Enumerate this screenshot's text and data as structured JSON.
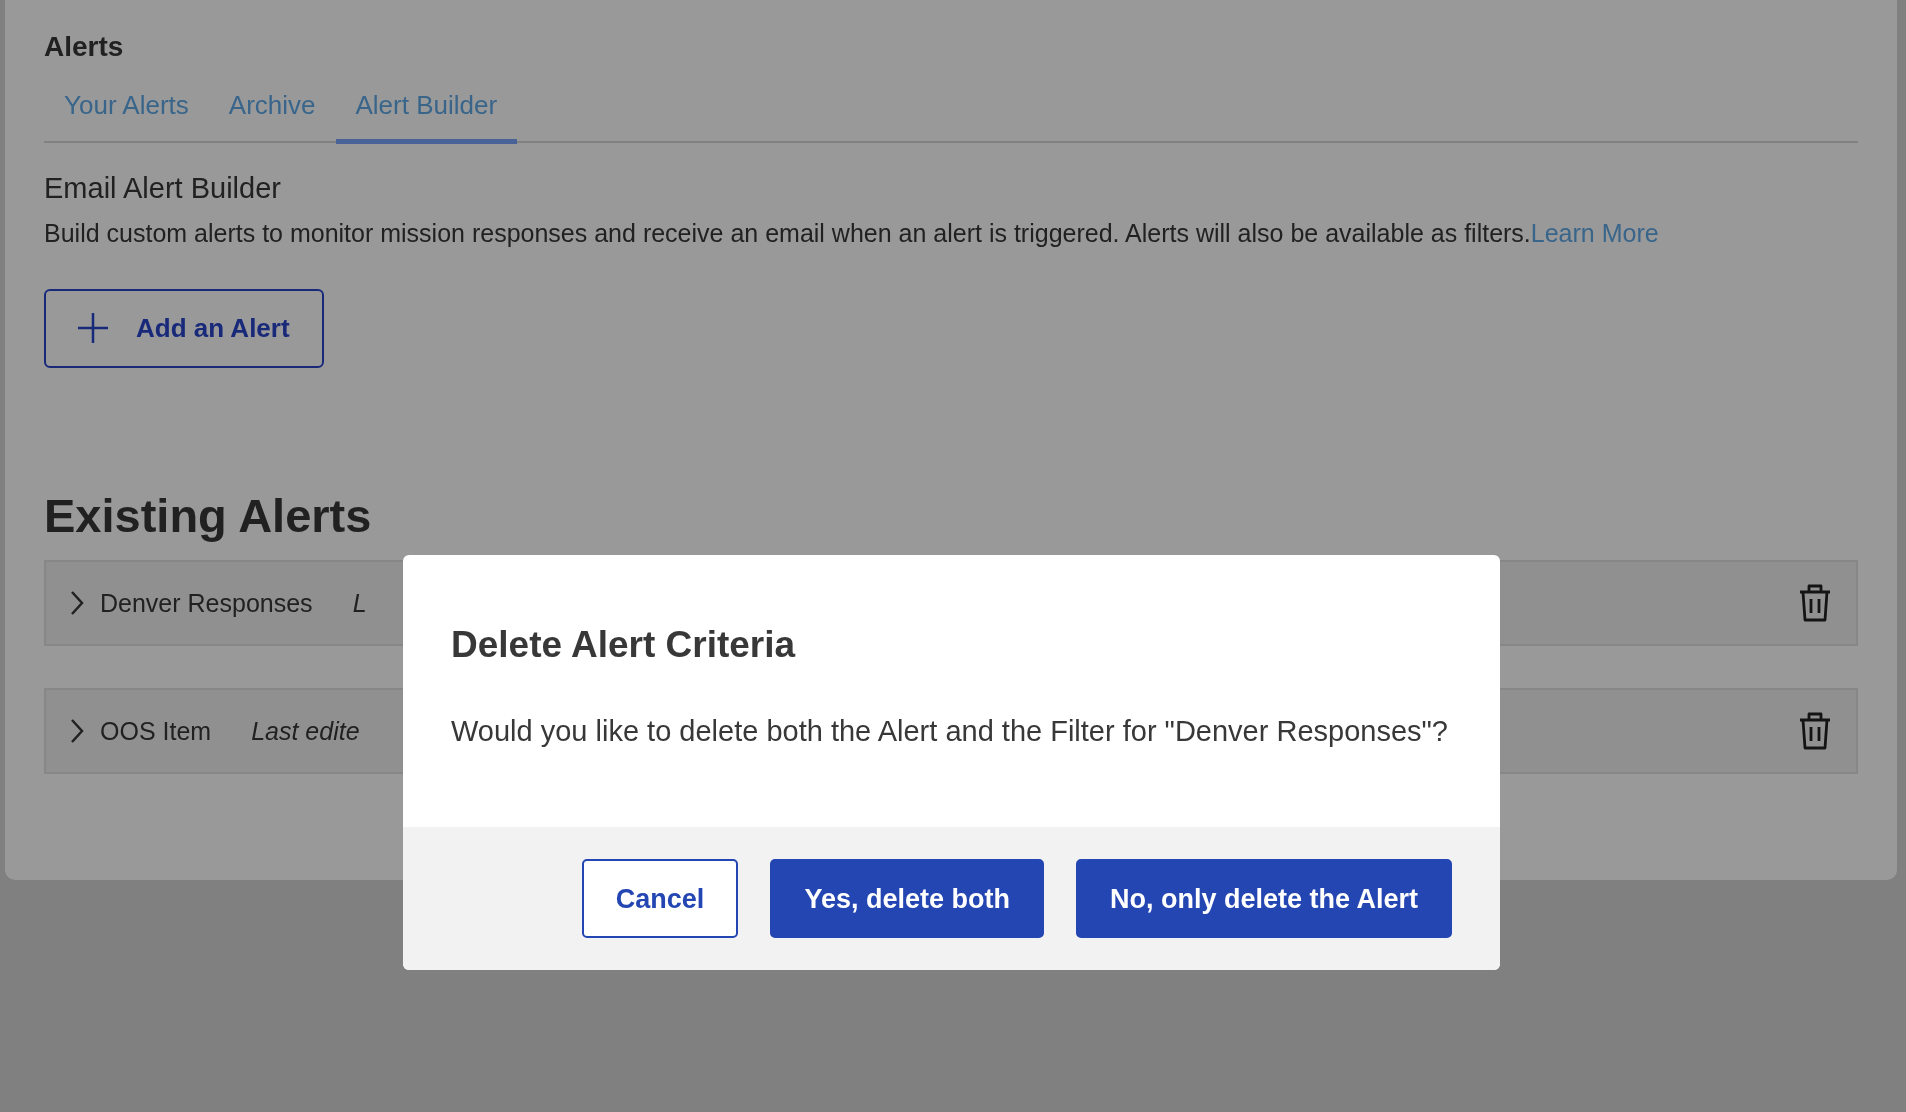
{
  "page": {
    "title": "Alerts"
  },
  "tabs": [
    {
      "label": "Your Alerts",
      "selected": false
    },
    {
      "label": "Archive",
      "selected": false
    },
    {
      "label": "Alert Builder",
      "selected": true
    }
  ],
  "builder": {
    "title": "Email Alert Builder",
    "description": "Build custom alerts to monitor mission responses and receive an email when an alert is triggered. Alerts will also be available as filters.",
    "link": "Learn More",
    "add_button": "Add an Alert"
  },
  "existing": {
    "title": "Existing Alerts",
    "rows": [
      {
        "name": "Denver Responses",
        "meta": "L"
      },
      {
        "name": "OOS Item",
        "meta": "Last edite"
      }
    ]
  },
  "dialog": {
    "title": "Delete Alert Criteria",
    "message": "Would you like to delete both the Alert and the Filter for \"Denver Responses\"?",
    "buttons": [
      {
        "label": "Cancel",
        "kind": "outline"
      },
      {
        "label": "Yes, delete both",
        "kind": "primary"
      },
      {
        "label": "No, only delete the Alert",
        "kind": "primary"
      }
    ]
  }
}
